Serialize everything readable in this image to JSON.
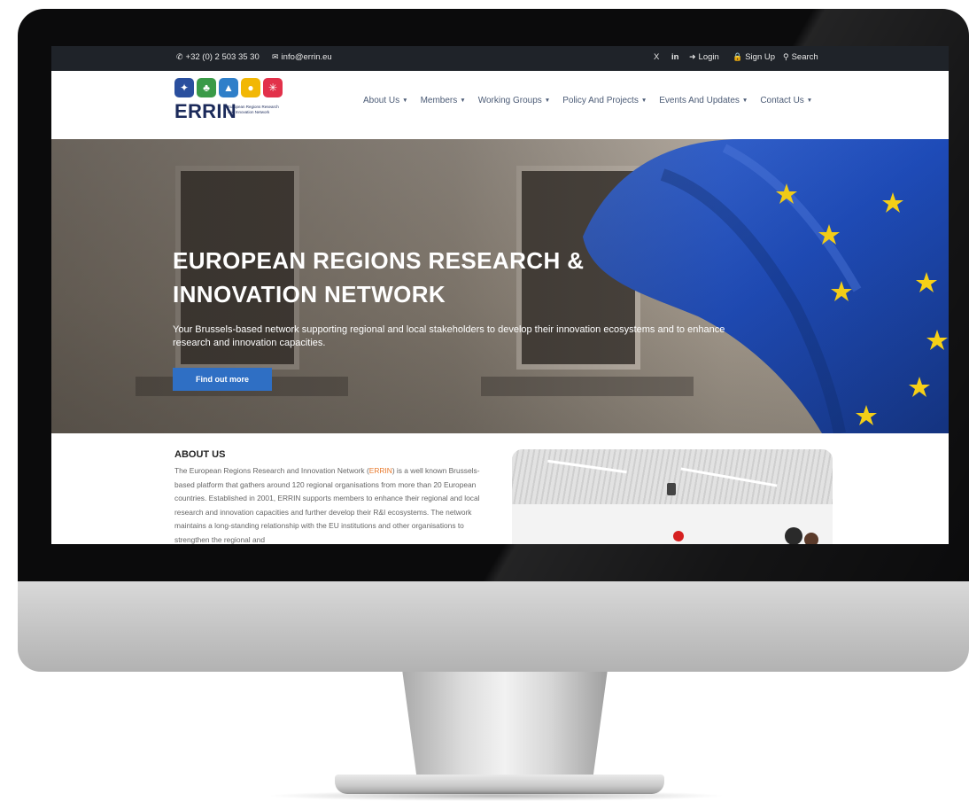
{
  "topbar": {
    "phone": "+32 (0) 2 503 35 30",
    "email": "info@errin.eu",
    "login": "Login",
    "signup": "Sign Up",
    "search": "Search",
    "social": {
      "x": "X",
      "linkedin": "in"
    }
  },
  "logo": {
    "wordmark": "ERRIN",
    "subtitle": "European Regions Research and Innovation Network",
    "tile_colors": [
      "#2a4f9e",
      "#3a9a48",
      "#2f7fc9",
      "#f2b705",
      "#e2314a"
    ]
  },
  "nav": {
    "items": [
      {
        "label": "About Us"
      },
      {
        "label": "Members"
      },
      {
        "label": "Working Groups"
      },
      {
        "label": "Policy And Projects"
      },
      {
        "label": "Events And Updates"
      },
      {
        "label": "Contact Us"
      }
    ]
  },
  "hero": {
    "title_line1": "EUROPEAN REGIONS RESEARCH &",
    "title_line2": "INNOVATION NETWORK",
    "subtitle": "Your Brussels-based network supporting regional and local stakeholders to develop their innovation ecosystems and to enhance research and innovation capacities.",
    "button": "Find out more"
  },
  "about": {
    "heading": "ABOUT US",
    "text_before": "The European Regions Research and Innovation Network (",
    "text_link": "ERRIN",
    "text_after": ") is a well known Brussels-based platform that gathers around 120 regional organisations from more than 20 European countries. Established in 2001, ERRIN supports members to enhance their regional and local research and innovation capacities and further develop their R&I ecosystems. The network maintains a long-standing relationship with the EU institutions and other organisations to strengthen the regional and"
  },
  "colors": {
    "topbar": "#1f2329",
    "button": "#2f6fc4",
    "link": "#e8782a",
    "flag": "#1e4bb8",
    "star": "#f7d117"
  }
}
